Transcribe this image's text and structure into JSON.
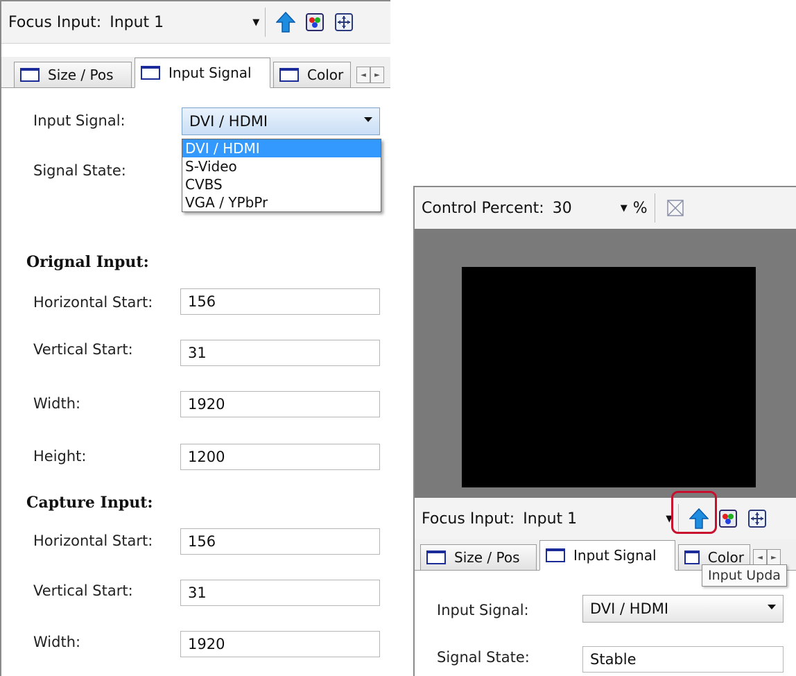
{
  "left_panel": {
    "toolbar": {
      "focus_label": "Focus Input:",
      "focus_value": "Input 1"
    },
    "tabs": [
      {
        "label": "Size / Pos"
      },
      {
        "label": "Input Signal"
      },
      {
        "label": "Color"
      }
    ],
    "input_signal": {
      "label": "Input Signal:",
      "value": "DVI / HDMI",
      "options": [
        "DVI / HDMI",
        "S-Video",
        "CVBS",
        "VGA / YPbPr"
      ],
      "selected_option": "DVI / HDMI"
    },
    "signal_state": {
      "label": "Signal State:"
    },
    "original_input": {
      "title": "Orignal Input:",
      "fields": [
        {
          "label": "Horizontal Start:",
          "value": "156"
        },
        {
          "label": "Vertical Start:",
          "value": "31"
        },
        {
          "label": "Width:",
          "value": "1920"
        },
        {
          "label": "Height:",
          "value": "1200"
        }
      ]
    },
    "capture_input": {
      "title": "Capture Input:",
      "fields": [
        {
          "label": "Horizontal Start:",
          "value": "156"
        },
        {
          "label": "Vertical Start:",
          "value": "31"
        },
        {
          "label": "Width:",
          "value": "1920"
        }
      ]
    }
  },
  "right_panel": {
    "control_percent": {
      "label": "Control Percent:",
      "value": "30",
      "unit": "%"
    },
    "toolbar": {
      "focus_label": "Focus Input:",
      "focus_value": "Input 1"
    },
    "tabs": [
      {
        "label": "Size / Pos"
      },
      {
        "label": "Input Signal"
      },
      {
        "label": "Color"
      }
    ],
    "tooltip": "Input Upda",
    "input_signal": {
      "label": "Input Signal:",
      "value": "DVI / HDMI"
    },
    "signal_state": {
      "label": "Signal State:",
      "value": "Stable"
    }
  },
  "colors": {
    "highlight": "#c8102e",
    "selection": "#3399ff",
    "preview_bg": "#7a7a7a"
  }
}
